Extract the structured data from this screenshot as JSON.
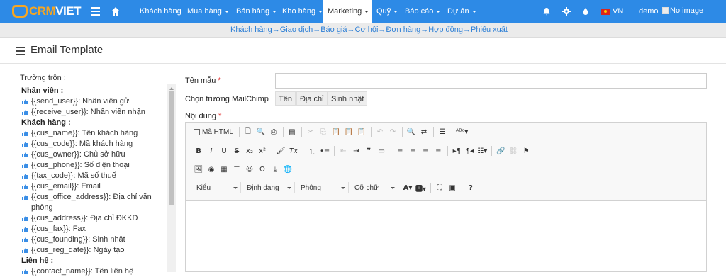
{
  "brand": {
    "part1": "CRM",
    "part2": "VIET"
  },
  "topnav": {
    "items": [
      {
        "label": "Khách hàng",
        "dropdown": false
      },
      {
        "label": "Mua hàng",
        "dropdown": true
      },
      {
        "label": "Bán hàng",
        "dropdown": true
      },
      {
        "label": "Kho hàng",
        "dropdown": true
      },
      {
        "label": "Marketing",
        "dropdown": true,
        "active": true
      },
      {
        "label": "Quỹ",
        "dropdown": true
      },
      {
        "label": "Báo cáo",
        "dropdown": true
      },
      {
        "label": "Dự án",
        "dropdown": true
      }
    ],
    "lang": "VN",
    "user": "demo",
    "avatar_alt": "No image"
  },
  "subnav": {
    "path": "Khách hàng→Giao dịch→Báo giá→Cơ hội→Đơn hàng→Hợp đồng→Phiếu xuất"
  },
  "page": {
    "title": "Email Template"
  },
  "merge": {
    "title": "Trường trộn :",
    "groups": [
      {
        "name": "Nhân viên :",
        "items": [
          "{{send_user}}: Nhân viên gửi",
          "{{receive_user}}: Nhân viên nhận"
        ]
      },
      {
        "name": "Khách hàng :",
        "items": [
          "{{cus_name}}: Tên khách hàng",
          "{{cus_code}}: Mã khách hàng",
          "{{cus_owner}}: Chủ sở hữu",
          "{{cus_phone}}: Số điện thoại",
          "{{tax_code}}: Mã số thuế",
          "{{cus_email}}: Email",
          "{{cus_office_address}}: Địa chỉ văn phòng",
          "{{cus_address}}: Địa chỉ ĐKKD",
          "{{cus_fax}}: Fax",
          "{{cus_founding}}: Sinh nhật",
          "{{cus_reg_date}}: Ngày tạo"
        ]
      },
      {
        "name": "Liên hệ :",
        "items": [
          "{{contact_name}}: Tên liên hệ"
        ]
      }
    ]
  },
  "form": {
    "template_name_label": "Tên mẫu",
    "required_mark": "*",
    "template_name_value": "",
    "mailchimp_label": "Chọn trường MailChimp",
    "mailchimp_fields": [
      "Tên",
      "Địa chỉ",
      "Sinh nhật"
    ],
    "content_label": "Nội dung"
  },
  "editor": {
    "source_label": "Mã HTML",
    "styles_label": "Kiểu",
    "format_label": "Định dạng",
    "font_label": "Phông",
    "size_label": "Cỡ chữ",
    "content": ""
  },
  "colors": {
    "topbar": "#2d8ae6",
    "logo_accent": "#f5a623",
    "link": "#2d7fd6"
  }
}
